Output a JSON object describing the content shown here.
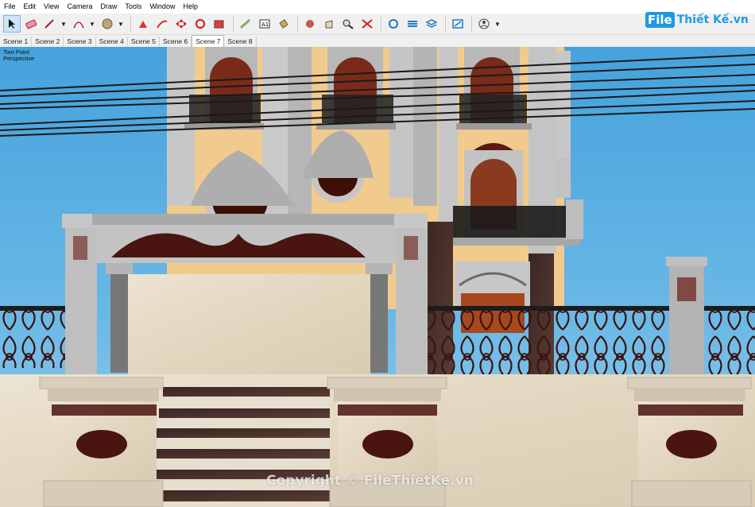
{
  "menu": [
    "File",
    "Edit",
    "View",
    "Camera",
    "Draw",
    "Tools",
    "Window",
    "Help"
  ],
  "toolbar": {
    "icons": [
      {
        "name": "select-arrow-icon",
        "active": true
      },
      {
        "name": "eraser-icon"
      },
      {
        "name": "pencil-line-icon",
        "caret": true
      },
      {
        "name": "arc-icon",
        "caret": true
      },
      {
        "name": "shape-circle-icon",
        "caret": true
      },
      {
        "sep": true
      },
      {
        "name": "push-pull-icon"
      },
      {
        "name": "follow-me-icon"
      },
      {
        "name": "move-icon"
      },
      {
        "name": "rotate-icon"
      },
      {
        "name": "scale-icon"
      },
      {
        "sep": true
      },
      {
        "name": "tape-measure-icon"
      },
      {
        "name": "text-icon"
      },
      {
        "name": "paint-bucket-icon"
      },
      {
        "sep": true
      },
      {
        "name": "orbit-icon"
      },
      {
        "name": "pan-icon"
      },
      {
        "name": "zoom-icon"
      },
      {
        "name": "zoom-extents-icon"
      },
      {
        "sep": true
      },
      {
        "name": "warehouse-icon"
      },
      {
        "name": "extension-warehouse-icon"
      },
      {
        "name": "layers-stack-icon"
      },
      {
        "sep": true
      },
      {
        "name": "extension-manager-icon"
      },
      {
        "sep": true
      },
      {
        "name": "user-account-icon",
        "caret": true
      }
    ]
  },
  "logo": {
    "box": "File",
    "text": "Thiết Kế.vn"
  },
  "scenes": [
    "Scene 1",
    "Scene 2",
    "Scene 3",
    "Scene 4",
    "Scene 5",
    "Scene 6",
    "Scene 7",
    "Scene 8"
  ],
  "active_scene": 6,
  "viewport": {
    "perspective_line1": "Two Point",
    "perspective_line2": "Perspective",
    "watermark": "Copyright © FileThietKe.vn"
  },
  "colors": {
    "sky": "#4aa5de",
    "marble": "#e6dcc8",
    "dark_ornament": "#4a1410",
    "stone_gray": "#b8b8b8",
    "facade_yellow": "#f1cb8d",
    "accent_blue": "#1e9ae0"
  }
}
